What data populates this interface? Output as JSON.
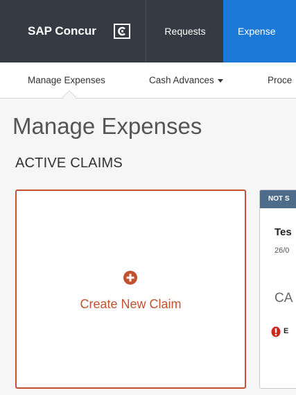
{
  "header": {
    "brand": "SAP Concur",
    "logo_icon": "concur-c-icon",
    "nav": {
      "requests": "Requests",
      "expense": "Expense"
    },
    "colors": {
      "bar": "#363b43",
      "active": "#1a79d6"
    }
  },
  "subnav": {
    "items": [
      {
        "label": "Manage Expenses",
        "active": true
      },
      {
        "label": "Cash Advances",
        "dropdown": true
      },
      {
        "label": "Proce"
      }
    ]
  },
  "main": {
    "title": "Manage Expenses",
    "section": "ACTIVE CLAIMS",
    "create_card": {
      "label": "Create New Claim",
      "icon": "plus-circle-icon",
      "accent": "#c3512f"
    },
    "claim_card": {
      "status": "NOT S",
      "name": "Tes",
      "date": "26/0",
      "amount": "CA",
      "alert_icon": "exclamation-circle-icon",
      "alert_text": "E"
    }
  }
}
